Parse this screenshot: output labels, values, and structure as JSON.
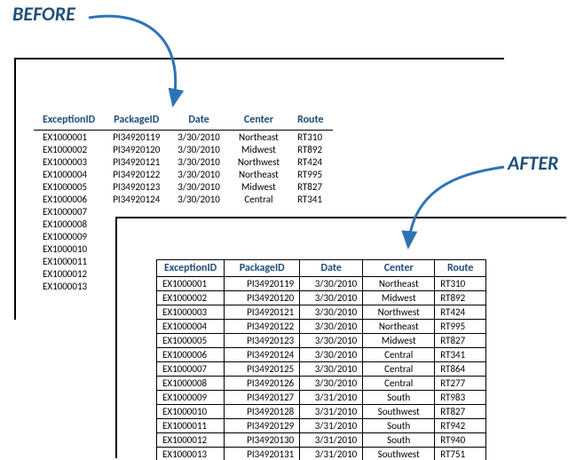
{
  "labels": {
    "before": "BEFORE",
    "after": "AFTER"
  },
  "headers": {
    "exception_id": "ExceptionID",
    "package_id": "PackageID",
    "date": "Date",
    "center": "Center",
    "route": "Route"
  },
  "before_rows": [
    {
      "exception_id": "EX1000001",
      "package_id": "PI34920119",
      "date": "3/30/2010",
      "center": "Northeast",
      "route": "RT310"
    },
    {
      "exception_id": "EX1000002",
      "package_id": "PI34920120",
      "date": "3/30/2010",
      "center": "Midwest",
      "route": "RT892"
    },
    {
      "exception_id": "EX1000003",
      "package_id": "PI34920121",
      "date": "3/30/2010",
      "center": "Northwest",
      "route": "RT424"
    },
    {
      "exception_id": "EX1000004",
      "package_id": "PI34920122",
      "date": "3/30/2010",
      "center": "Northeast",
      "route": "RT995"
    },
    {
      "exception_id": "EX1000005",
      "package_id": "PI34920123",
      "date": "3/30/2010",
      "center": "Midwest",
      "route": "RT827"
    },
    {
      "exception_id": "EX1000006",
      "package_id": "PI34920124",
      "date": "3/30/2010",
      "center": "Central",
      "route": "RT341"
    },
    {
      "exception_id": "EX1000007",
      "package_id": "",
      "date": "",
      "center": "",
      "route": ""
    },
    {
      "exception_id": "EX1000008",
      "package_id": "",
      "date": "",
      "center": "",
      "route": ""
    },
    {
      "exception_id": "EX1000009",
      "package_id": "",
      "date": "",
      "center": "",
      "route": ""
    },
    {
      "exception_id": "EX1000010",
      "package_id": "",
      "date": "",
      "center": "",
      "route": ""
    },
    {
      "exception_id": "EX1000011",
      "package_id": "",
      "date": "",
      "center": "",
      "route": ""
    },
    {
      "exception_id": "EX1000012",
      "package_id": "",
      "date": "",
      "center": "",
      "route": ""
    },
    {
      "exception_id": "EX1000013",
      "package_id": "",
      "date": "",
      "center": "",
      "route": ""
    }
  ],
  "after_rows": [
    {
      "exception_id": "EX1000001",
      "package_id": "PI34920119",
      "date": "3/30/2010",
      "center": "Northeast",
      "route": "RT310"
    },
    {
      "exception_id": "EX1000002",
      "package_id": "PI34920120",
      "date": "3/30/2010",
      "center": "Midwest",
      "route": "RT892"
    },
    {
      "exception_id": "EX1000003",
      "package_id": "PI34920121",
      "date": "3/30/2010",
      "center": "Northwest",
      "route": "RT424"
    },
    {
      "exception_id": "EX1000004",
      "package_id": "PI34920122",
      "date": "3/30/2010",
      "center": "Northeast",
      "route": "RT995"
    },
    {
      "exception_id": "EX1000005",
      "package_id": "PI34920123",
      "date": "3/30/2010",
      "center": "Midwest",
      "route": "RT827"
    },
    {
      "exception_id": "EX1000006",
      "package_id": "PI34920124",
      "date": "3/30/2010",
      "center": "Central",
      "route": "RT341"
    },
    {
      "exception_id": "EX1000007",
      "package_id": "PI34920125",
      "date": "3/30/2010",
      "center": "Central",
      "route": "RT864"
    },
    {
      "exception_id": "EX1000008",
      "package_id": "PI34920126",
      "date": "3/30/2010",
      "center": "Central",
      "route": "RT277"
    },
    {
      "exception_id": "EX1000009",
      "package_id": "PI34920127",
      "date": "3/31/2010",
      "center": "South",
      "route": "RT983"
    },
    {
      "exception_id": "EX1000010",
      "package_id": "PI34920128",
      "date": "3/31/2010",
      "center": "Southwest",
      "route": "RT827"
    },
    {
      "exception_id": "EX1000011",
      "package_id": "PI34920129",
      "date": "3/31/2010",
      "center": "South",
      "route": "RT942"
    },
    {
      "exception_id": "EX1000012",
      "package_id": "PI34920130",
      "date": "3/31/2010",
      "center": "South",
      "route": "RT940"
    },
    {
      "exception_id": "EX1000013",
      "package_id": "PI34920131",
      "date": "3/31/2010",
      "center": "Southwest",
      "route": "RT751"
    }
  ]
}
